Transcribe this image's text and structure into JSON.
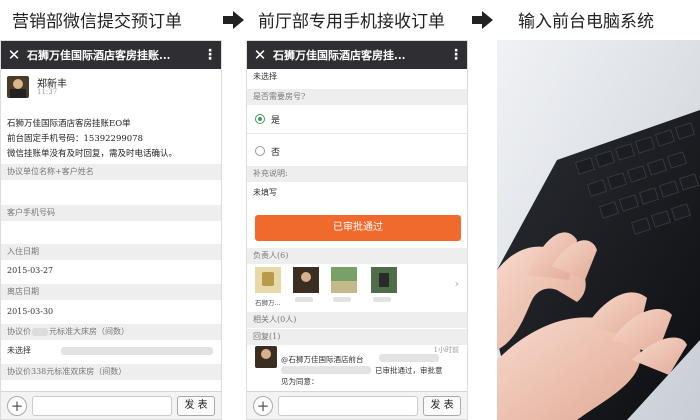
{
  "steps": {
    "step1": "营销部微信提交预订单",
    "step2": "前厅部专用手机接收订单",
    "step3": "输入前台电脑系统"
  },
  "phone1": {
    "title": "石狮万佳国际酒店客房挂账...",
    "sender": "郑新丰",
    "time": "11:37",
    "message_line1": "石狮万佳国际酒店客房挂账EO单",
    "message_line2": "前台固定手机号码：15392299078",
    "message_line3": "微信挂账单没有及时回复，需及时电话确认。",
    "fields": [
      {
        "label": "协议单位名称+客户姓名",
        "value": ""
      },
      {
        "label": "客户手机号码",
        "value": ""
      },
      {
        "label": "入住日期",
        "value": "2015-03-27"
      },
      {
        "label": "离店日期",
        "value": "2015-03-30"
      }
    ],
    "field_room1_label": "协议价",
    "field_room1_label_tail": "元标准大床房（间数）",
    "field_room1_value": "未选择",
    "field_room2_label": "协议价338元标准双床房（间数）",
    "send_label": "发 表"
  },
  "phone2": {
    "title": "石狮万佳国际酒店客房挂...",
    "unselected_top": "未选择",
    "need_room_label": "是否需要房号?",
    "option_yes": "是",
    "option_no": "否",
    "supplement_label": "补充说明:",
    "supplement_value": "未填写",
    "approve_label": "已审批通过",
    "responsible_label": "负责人(6)",
    "first_person_name": "石狮万...",
    "related_label": "相关人(0人)",
    "reply_label": "回复(1)",
    "reply_time": "1小时前",
    "reply_line1": "@石狮万佳国际酒店前台",
    "reply_line2": "已审批通过，审批意",
    "reply_line3": "见为同意：",
    "send_label": "发 表"
  },
  "colors": {
    "topbar": "#2f2f33",
    "approve": "#ef6a2c",
    "radio_on": "#3b9d5b"
  }
}
